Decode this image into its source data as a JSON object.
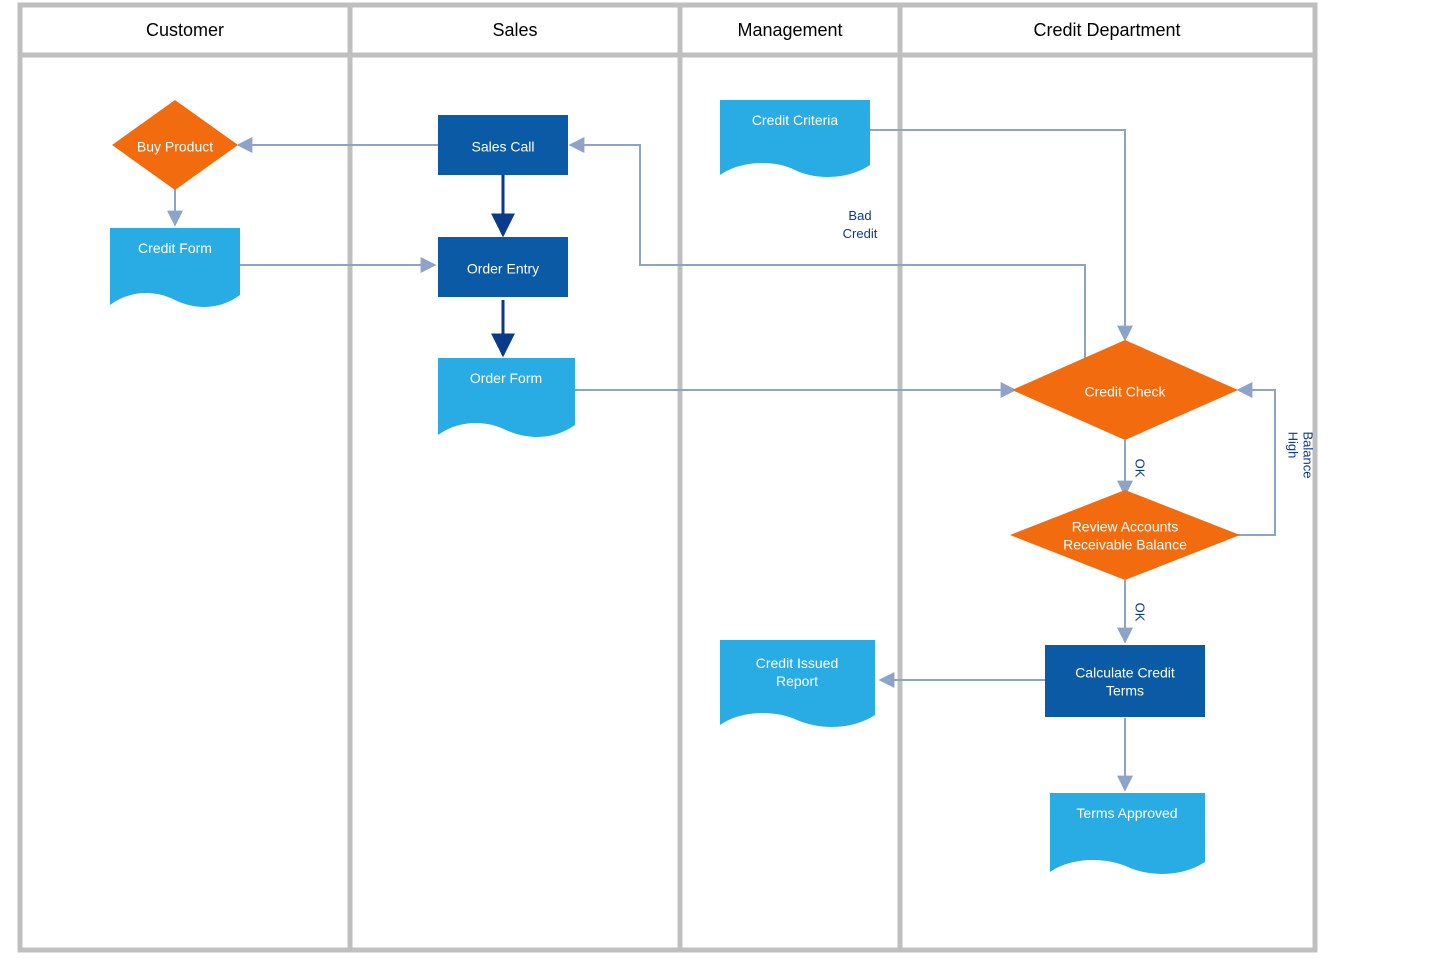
{
  "lanes": {
    "customer": "Customer",
    "sales": "Sales",
    "management": "Management",
    "credit_dept": "Credit Department"
  },
  "nodes": {
    "buy_product": "Buy Product",
    "credit_form": "Credit Form",
    "sales_call": "Sales Call",
    "order_entry": "Order Entry",
    "order_form": "Order Form",
    "credit_criteria": "Credit Criteria",
    "credit_issued_report_l1": "Credit Issued",
    "credit_issued_report_l2": "Report",
    "credit_check": "Credit Check",
    "review_ar_l1": "Review Accounts",
    "review_ar_l2": "Receivable Balance",
    "calc_terms_l1": "Calculate Credit",
    "calc_terms_l2": "Terms",
    "terms_approved": "Terms Approved"
  },
  "edges": {
    "bad_credit_l1": "Bad",
    "bad_credit_l2": "Credit",
    "ok1": "OK",
    "ok2": "OK",
    "high_balance_l1": "High",
    "high_balance_l2": "Balance"
  },
  "colors": {
    "grid": "#bfbfbf",
    "process": "#0a5aa6",
    "decision": "#f26b0f",
    "document": "#29ace3",
    "arrow": "#8ea3c8"
  },
  "diagram_type": "cross-functional swimlane flowchart"
}
